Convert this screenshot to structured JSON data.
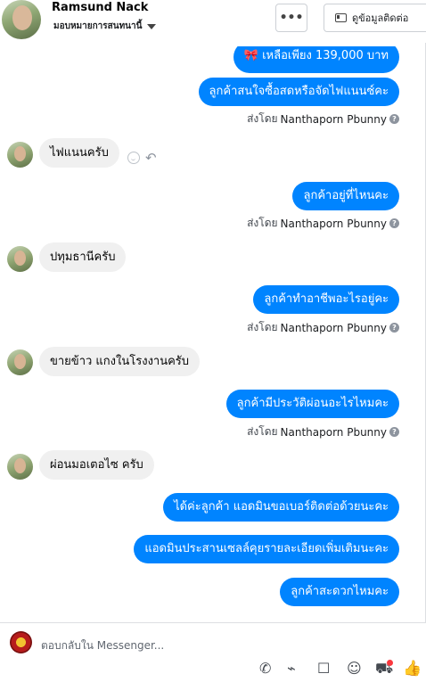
{
  "header": {
    "name": "Ramsund Nack",
    "assign_label": "มอบหมายการสนทนานี้",
    "more_label": "•••",
    "contact_label": "ดูข้อมูลติดต่อ"
  },
  "conversation": {
    "sent_by_prefix": "ส่งโดย",
    "sent_by_name": "Nanthaporn Pbunny",
    "messages": [
      {
        "dir": "out",
        "text": "🎀 เหลือเพียง 139,000 บาท"
      },
      {
        "dir": "out",
        "text": "ลูกค้าสนใจซื้อสดหรือจัดไฟแนนซ์คะ"
      },
      {
        "dir": "in",
        "text": "ไฟแนนครับ"
      },
      {
        "dir": "out",
        "text": "ลูกค้าอยู่ที่ไหนคะ"
      },
      {
        "dir": "in",
        "text": "ปทุมธานีครับ"
      },
      {
        "dir": "out",
        "text": "ลูกค้าทำอาชีพอะไรอยู่คะ"
      },
      {
        "dir": "in",
        "text": "ขายข้าว แกงในโรงงานครับ"
      },
      {
        "dir": "out",
        "text": "ลูกค้ามีประวัติผ่อนอะไรไหมคะ"
      },
      {
        "dir": "in",
        "text": "ผ่อนมอเตอไซ ครับ"
      },
      {
        "dir": "out",
        "text": "ได้ค่ะลูกค้า แอดมินขอเบอร์ติดต่อด้วยนะคะ"
      },
      {
        "dir": "out",
        "text": "แอดมินประสานเซลล์คุยรายละเอียดเพิ่มเติมนะคะ"
      },
      {
        "dir": "out",
        "text": "ลูกค้าสะดวกไหมคะ"
      }
    ]
  },
  "composer": {
    "placeholder": "ตอบกลับใน Messenger..."
  },
  "icons": [
    "chevron-down-icon",
    "more-icon",
    "contact-card-icon",
    "question-icon",
    "smile-icon",
    "reply-icon",
    "phone-icon",
    "attachment-icon",
    "chat-icon",
    "emoji-icon",
    "cart-icon",
    "like-icon"
  ],
  "colors": {
    "accent": "#0084ff",
    "incoming_bubble": "#f0f0f0",
    "notification": "#fa383e"
  }
}
